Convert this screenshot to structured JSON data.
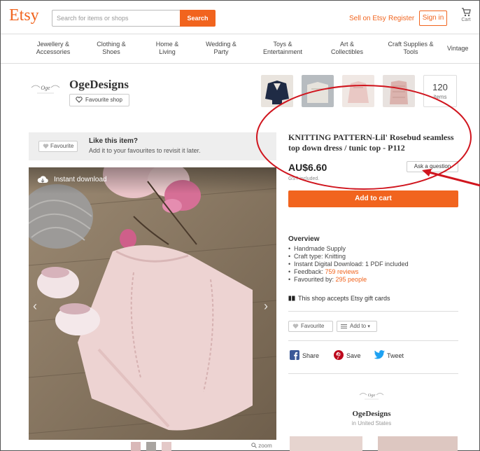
{
  "header": {
    "logo": "Etsy",
    "search_placeholder": "Search for items or shops",
    "search_button": "Search",
    "sell_link": "Sell on Etsy",
    "register_link": "Register",
    "signin_button": "Sign in",
    "cart_label": "Cart"
  },
  "categories": [
    {
      "line1": "Jewellery &",
      "line2": "Accessories"
    },
    {
      "line1": "Clothing &",
      "line2": "Shoes"
    },
    {
      "line1": "Home &",
      "line2": "Living"
    },
    {
      "line1": "Wedding &",
      "line2": "Party"
    },
    {
      "line1": "Toys &",
      "line2": "Entertainment"
    },
    {
      "line1": "Art &",
      "line2": "Collectibles"
    },
    {
      "line1": "Craft Supplies &",
      "line2": "Tools"
    },
    {
      "line1": "Vintage",
      "line2": ""
    }
  ],
  "shop": {
    "logo_text": "Oge",
    "name": "OgeDesigns",
    "favourite_button": "Favourite shop",
    "items_count": "120",
    "items_label": "items"
  },
  "favourite_bar": {
    "button": "Favourite",
    "title": "Like this item?",
    "subtitle": "Add it to your favourites to revisit it later."
  },
  "image": {
    "instant_download": "Instant download",
    "zoom_label": "zoom"
  },
  "listing": {
    "title": "KNITTING PATTERN-Lil' Rosebud seamless top down dress / tunic top - P112",
    "price": "AU$6.60",
    "ask_button": "Ask a question",
    "tax_note": "GST included.",
    "add_to_cart": "Add to cart",
    "overview_title": "Overview",
    "overview_items": [
      {
        "text": "Handmade Supply",
        "link": ""
      },
      {
        "text": "Craft type: Knitting",
        "link": ""
      },
      {
        "text": "Instant Digital Download: 1 PDF included",
        "link": ""
      },
      {
        "text": "Feedback: ",
        "link": "759 reviews"
      },
      {
        "text": "Favourited by: ",
        "link": "295 people"
      }
    ],
    "gift_cards": "This shop accepts Etsy gift cards",
    "favourite_button": "Favourite",
    "add_to_button": "Add to",
    "share": {
      "facebook": "Share",
      "pinterest": "Save",
      "twitter": "Tweet"
    },
    "shop_footer_name": "OgeDesigns",
    "shop_footer_location": "in United States"
  },
  "colors": {
    "accent": "#F1641E",
    "annotation": "#D0151E"
  }
}
